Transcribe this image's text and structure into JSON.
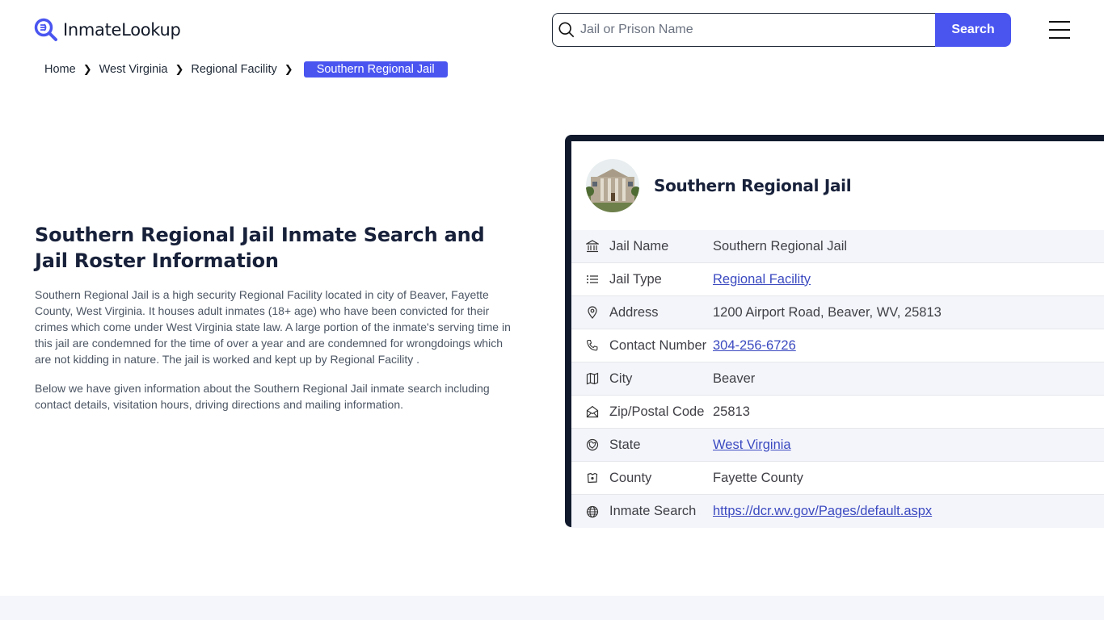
{
  "brand": {
    "name": "InmateLookup",
    "accent": "#4a55f0",
    "dark": "#111a2d"
  },
  "search": {
    "placeholder": "Jail or Prison Name",
    "value": "",
    "button_label": "Search"
  },
  "breadcrumb": {
    "items": [
      "Home",
      "West Virginia",
      "Regional Facility"
    ],
    "current": "Southern Regional Jail"
  },
  "intro": {
    "title": "Southern Regional Jail Inmate Search and Jail Roster Information",
    "paragraphs": [
      "Southern Regional Jail is a high security Regional Facility located in city of Beaver, Fayette County, West Virginia. It houses adult inmates (18+ age) who have been convicted for their crimes which come under West Virginia state law. A large portion of the inmate's serving time in this jail are condemned for the time of over a year and are condemned for wrongdoings which are not kidding in nature. The jail is worked and kept up by Regional Facility .",
      "Below we have given information about the Southern Regional Jail inmate search including contact details, visitation hours, driving directions and mailing information."
    ]
  },
  "card": {
    "title": "Southern Regional Jail",
    "rows": [
      {
        "icon": "bank-icon",
        "label": "Jail Name",
        "value": "Southern Regional Jail",
        "link": false
      },
      {
        "icon": "list-icon",
        "label": "Jail Type",
        "value": "Regional Facility",
        "link": true
      },
      {
        "icon": "map-pin-icon",
        "label": "Address",
        "value": "1200 Airport Road, Beaver, WV, 25813",
        "link": false
      },
      {
        "icon": "phone-icon",
        "label": "Contact Number",
        "value": "304-256-6726",
        "link": true
      },
      {
        "icon": "map-icon",
        "label": "City",
        "value": "Beaver",
        "link": false
      },
      {
        "icon": "mail-open-icon",
        "label": "Zip/Postal Code",
        "value": "25813",
        "link": false
      },
      {
        "icon": "state-icon",
        "label": "State",
        "value": "West Virginia",
        "link": true
      },
      {
        "icon": "county-icon",
        "label": "County",
        "value": "Fayette County",
        "link": false
      },
      {
        "icon": "globe-icon",
        "label": "Inmate Search",
        "value": "https://dcr.wv.gov/Pages/default.aspx",
        "link": true
      }
    ]
  }
}
